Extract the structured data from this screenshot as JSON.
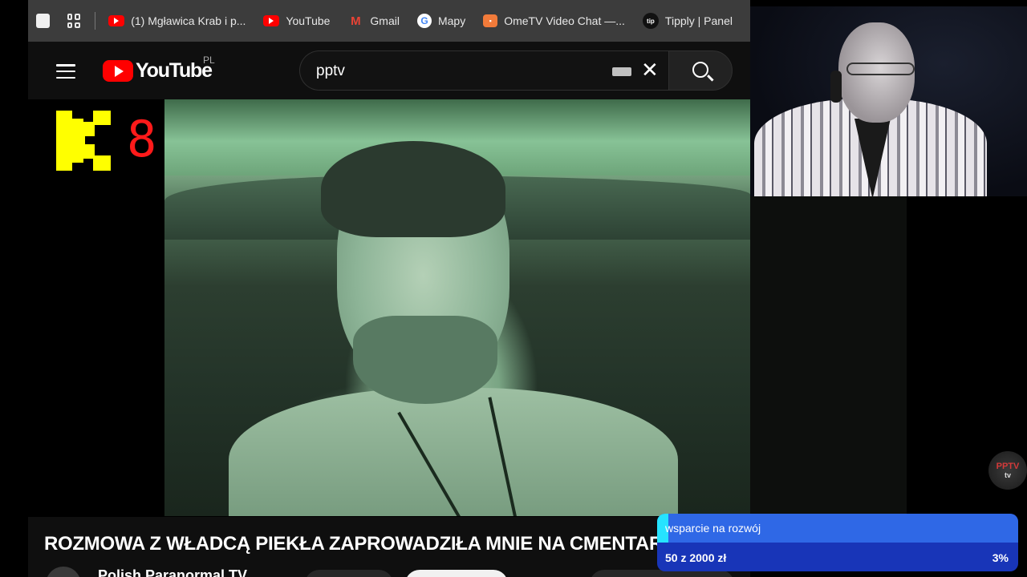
{
  "bookmarks": [
    {
      "label": "(1) Mgławica Krab i p...",
      "icon": "youtube-icon"
    },
    {
      "label": "YouTube",
      "icon": "youtube-icon"
    },
    {
      "label": "Gmail",
      "icon": "gmail-icon"
    },
    {
      "label": "Mapy",
      "icon": "google-maps-icon"
    },
    {
      "label": "OmeTV Video Chat —...",
      "icon": "ometv-icon"
    },
    {
      "label": "Tipply | Panel",
      "icon": "tipply-icon"
    }
  ],
  "header": {
    "logo_text": "YouTube",
    "country_code": "PL",
    "search_value": "pptv",
    "clear_symbol": "✕"
  },
  "overlay": {
    "k8_digit": "8"
  },
  "video": {
    "title": "ROZMOWA Z WŁADCĄ PIEKŁA ZAPROWADZIŁA MNIE NA CMENTARZ...",
    "channel": "Polish Paranormal TV"
  },
  "badge": {
    "name": "PPTV",
    "sub": "tv"
  },
  "support_widget": {
    "label": "wsparcie na rozwój",
    "amount": "50 z 2000 zł",
    "percent": "3%",
    "progress": 0.03
  },
  "colors": {
    "youtube_red": "#ff0000",
    "k_yellow": "#ffff00",
    "eight_red": "#ff1a1a",
    "support_blue": "#2f68e6",
    "support_progress": "#26e3ff"
  }
}
